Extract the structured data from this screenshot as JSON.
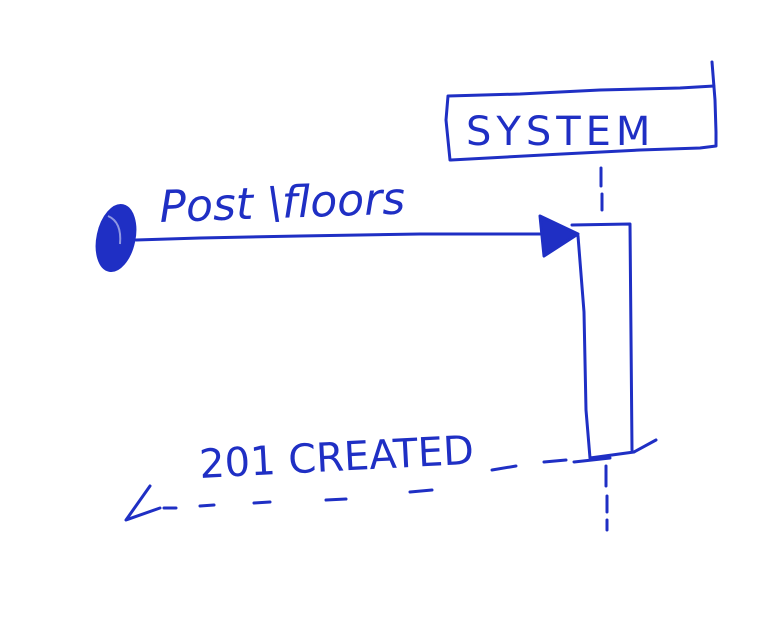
{
  "participant": {
    "name": "SYSTEM"
  },
  "request": {
    "label": "Post \\floors"
  },
  "response": {
    "label": "201 CREATED"
  },
  "colors": {
    "ink": "#1f2fc4",
    "background": "#ffffff"
  }
}
